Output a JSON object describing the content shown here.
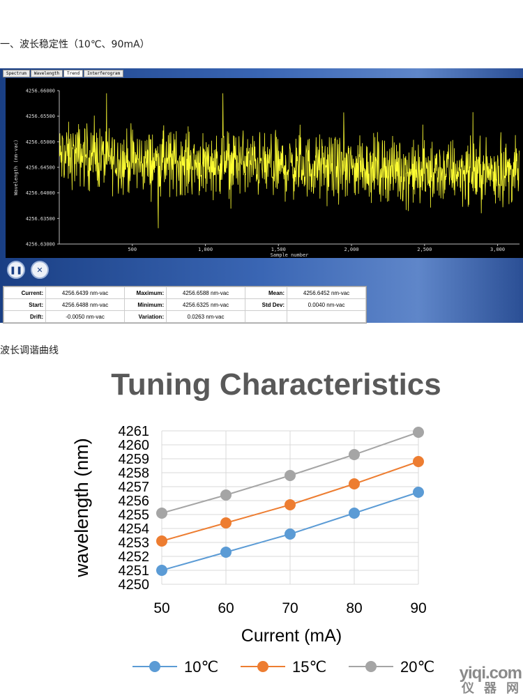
{
  "headings": {
    "stability": "一、波长稳定性（10℃、90mA）",
    "tuning": "波长调谐曲线"
  },
  "meter": {
    "tabs": [
      "Spectrum",
      "Wavelength",
      "Trend",
      "Interferogram"
    ],
    "active_tab": "Trend",
    "controls": {
      "pause": "pause-icon",
      "close": "close-icon"
    },
    "stats": [
      [
        {
          "label": "Current:",
          "value": "4256.6439 nm-vac"
        },
        {
          "label": "Maximum:",
          "value": "4256.6588 nm-vac"
        },
        {
          "label": "Mean:",
          "value": "4256.6452 nm-vac"
        }
      ],
      [
        {
          "label": "Start:",
          "value": "4256.6488 nm-vac"
        },
        {
          "label": "Minimum:",
          "value": "4256.6325 nm-vac"
        },
        {
          "label": "Std Dev:",
          "value": "0.0040 nm-vac"
        }
      ],
      [
        {
          "label": "Drift:",
          "value": "-0.0050 nm-vac"
        },
        {
          "label": "Variation:",
          "value": "0.0263 nm-vac"
        },
        {
          "label": "",
          "value": ""
        }
      ]
    ]
  },
  "chart_data": [
    {
      "type": "line",
      "title": "",
      "xlabel": "Sample number",
      "ylabel": "Wavelength (nm-vac)",
      "xlim": [
        0,
        3150
      ],
      "ylim": [
        4256.63,
        4256.66
      ],
      "x_ticks": [
        500,
        1000,
        1500,
        2000,
        2500,
        3000
      ],
      "x_tick_labels": [
        "500",
        "1,000",
        "1,500",
        "2,000",
        "2,500",
        "3,000"
      ],
      "y_ticks": [
        4256.63,
        4256.635,
        4256.64,
        4256.645,
        4256.65,
        4256.655,
        4256.66
      ],
      "y_tick_labels": [
        "4256.63000",
        "4256.63500",
        "4256.64000",
        "4256.64500",
        "4256.65000",
        "4256.65500",
        "4256.66000"
      ],
      "grid": false,
      "series": [
        {
          "color": "#ffff33",
          "x": [
            0,
            150,
            300,
            450,
            600,
            750,
            900,
            1050,
            1200,
            1350,
            1500,
            1650,
            1800,
            1950,
            2100,
            2250,
            2400,
            2550,
            2700,
            2850,
            3000,
            3150
          ],
          "y": [
            4256.647,
            4256.6475,
            4256.6468,
            4256.6462,
            4256.646,
            4256.6462,
            4256.646,
            4256.6458,
            4256.6462,
            4256.6455,
            4256.645,
            4256.6452,
            4256.645,
            4256.6448,
            4256.6452,
            4256.6448,
            4256.644,
            4256.6438,
            4256.6445,
            4256.644,
            4256.6442,
            4256.644
          ]
        }
      ]
    },
    {
      "type": "line",
      "title": "Tuning Characteristics",
      "xlabel": "Current (mA)",
      "ylabel": "wavelength (nm)",
      "categories": [
        50,
        60,
        70,
        80,
        90
      ],
      "ylim": [
        4250,
        4261
      ],
      "y_ticks": [
        4250,
        4251,
        4252,
        4253,
        4254,
        4255,
        4256,
        4257,
        4258,
        4259,
        4260,
        4261
      ],
      "grid": true,
      "legend_position": "bottom",
      "series": [
        {
          "name": "10℃",
          "color": "#5b9bd5",
          "values": [
            4251.0,
            4252.3,
            4253.6,
            4255.1,
            4256.6
          ]
        },
        {
          "name": "15℃",
          "color": "#ed7d31",
          "values": [
            4253.1,
            4254.4,
            4255.7,
            4257.2,
            4258.8
          ]
        },
        {
          "name": "20℃",
          "color": "#a5a5a5",
          "values": [
            4255.1,
            4256.4,
            4257.8,
            4259.3,
            4260.9
          ]
        }
      ]
    }
  ],
  "watermark": {
    "line1": "yiqi.com",
    "line2": "仪器网"
  }
}
